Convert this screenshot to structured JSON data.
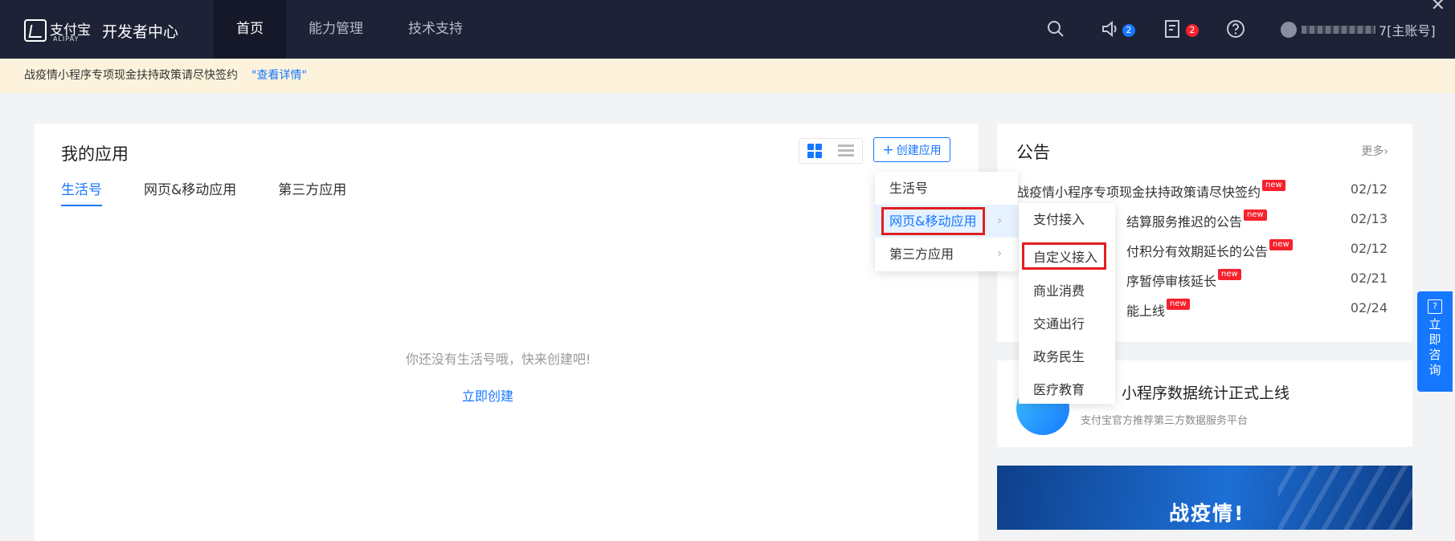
{
  "header": {
    "logo_cn": "支付宝",
    "logo_en": "ALIPAY",
    "title": "开发者中心",
    "nav": [
      {
        "label": "首页",
        "active": true
      },
      {
        "label": "能力管理",
        "active": false
      },
      {
        "label": "技术支持",
        "active": false
      }
    ],
    "notifications_count": "2",
    "messages_count": "2",
    "account_suffix": "7[主账号]"
  },
  "notice": {
    "text": "战疫情小程序专项现金扶持政策请尽快签约",
    "link": "\"查看详情\""
  },
  "apps": {
    "title": "我的应用",
    "create_label": "创建应用",
    "tabs": [
      "生活号",
      "网页&移动应用",
      "第三方应用"
    ],
    "empty_text": "你还没有生活号哦，快来创建吧!",
    "empty_link": "立即创建"
  },
  "dropdown": {
    "items": [
      "生活号",
      "网页&移动应用",
      "第三方应用"
    ],
    "submenu": [
      "支付接入",
      "自定义接入",
      "商业消费",
      "交通出行",
      "政务民生",
      "医疗教育"
    ]
  },
  "announcements": {
    "title": "公告",
    "more": "更多",
    "rows": [
      {
        "text": "战疫情小程序专项现金扶持政策请尽快签约",
        "date": "02/12"
      },
      {
        "text": "结算服务推迟的公告",
        "date": "02/13"
      },
      {
        "text": "付积分有效期延长的公告",
        "date": "02/12"
      },
      {
        "text": "序暂停审核延长",
        "date": "02/21"
      },
      {
        "text": "能上线",
        "date": "02/24"
      }
    ],
    "new_tag": "new"
  },
  "stats_card": {
    "title": "小程序数据统计正式上线",
    "subtitle": "支付宝官方推荐第三方数据服务平台"
  },
  "banner": {
    "text": "战疫情!"
  },
  "consult": {
    "chars": [
      "立",
      "即",
      "咨",
      "询"
    ]
  }
}
